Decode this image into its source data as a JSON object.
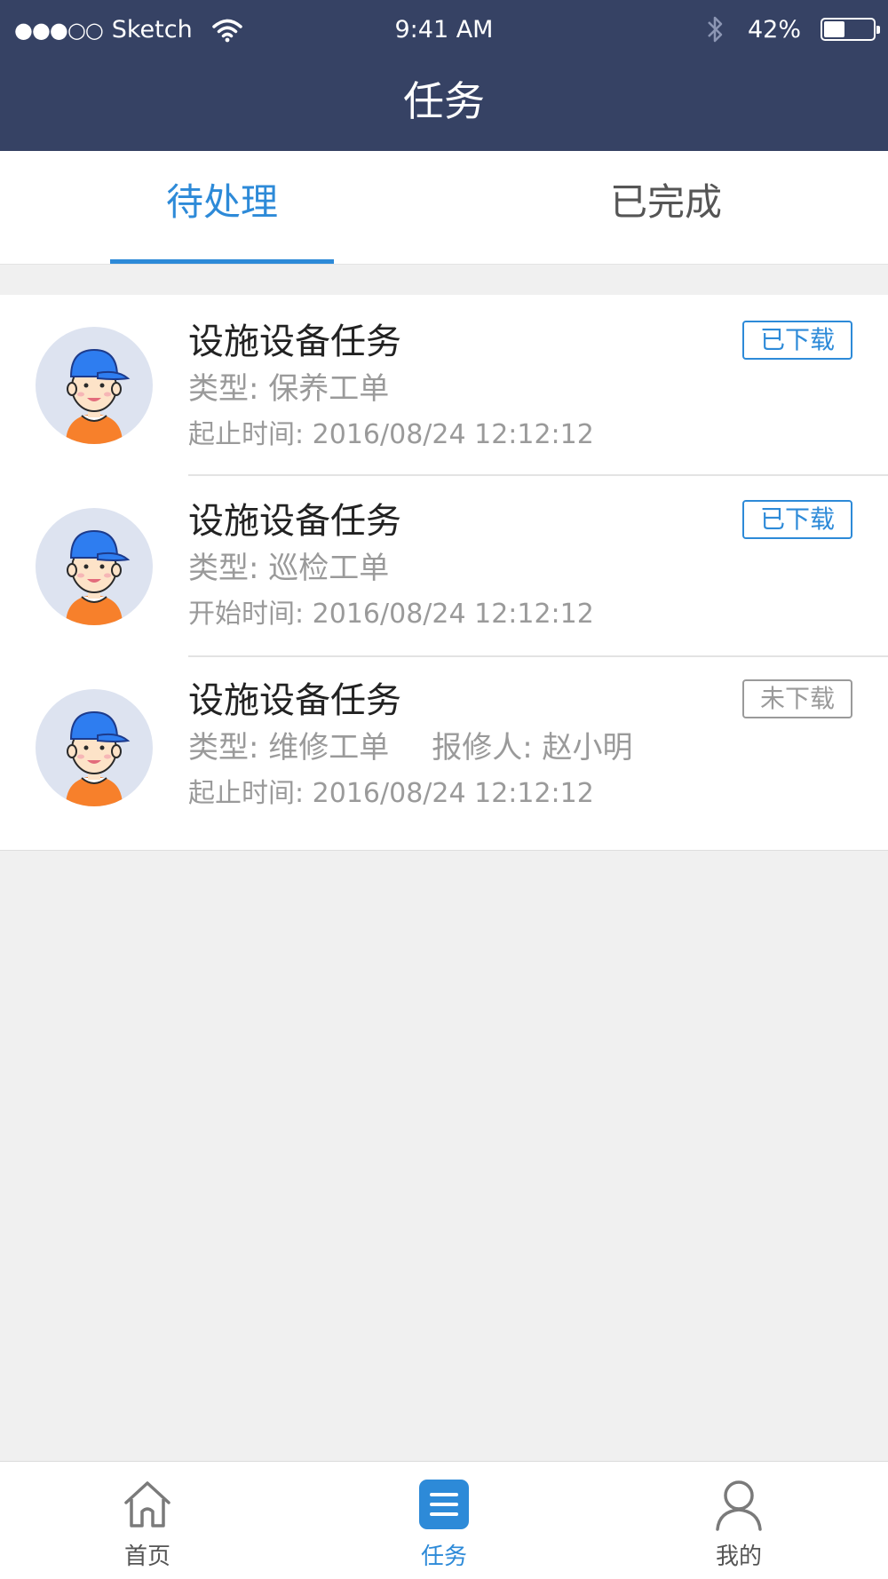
{
  "status_bar": {
    "signal": "●●●○○",
    "carrier": "Sketch",
    "time": "9:41 AM",
    "battery_percent": "42%",
    "battery_level": 0.42
  },
  "header": {
    "title": "任务"
  },
  "tabs": [
    {
      "label": "待处理",
      "active": true
    },
    {
      "label": "已完成",
      "active": false
    }
  ],
  "tasks": [
    {
      "title": "设施设备任务",
      "type": "类型: 保养工单",
      "reporter": "",
      "time_label": "起止时间: ",
      "time_value": "2016/08/24 12:12:12",
      "status": "已下载",
      "status_color": "#2d8ad8"
    },
    {
      "title": "设施设备任务",
      "type": "类型: 巡检工单",
      "reporter": "",
      "time_label": "开始时间: ",
      "time_value": "2016/08/24 12:12:12",
      "status": "已下载",
      "status_color": "#2d8ad8"
    },
    {
      "title": "设施设备任务",
      "type": "类型: 维修工单",
      "reporter": "报修人: 赵小明",
      "time_label": "起止时间: ",
      "time_value": "2016/08/24 12:12:12",
      "status": "未下载",
      "status_color": "#9a9a9a"
    }
  ],
  "tabbar": {
    "items": [
      {
        "label": "首页",
        "icon": "home-icon",
        "active": false
      },
      {
        "label": "任务",
        "icon": "task-list-icon",
        "active": true
      },
      {
        "label": "我的",
        "icon": "user-icon",
        "active": false
      }
    ]
  },
  "colors": {
    "header_bg": "#364264",
    "accent": "#2d8ad8",
    "muted": "#9a9a9a",
    "page_bg": "#f0f0f0"
  }
}
